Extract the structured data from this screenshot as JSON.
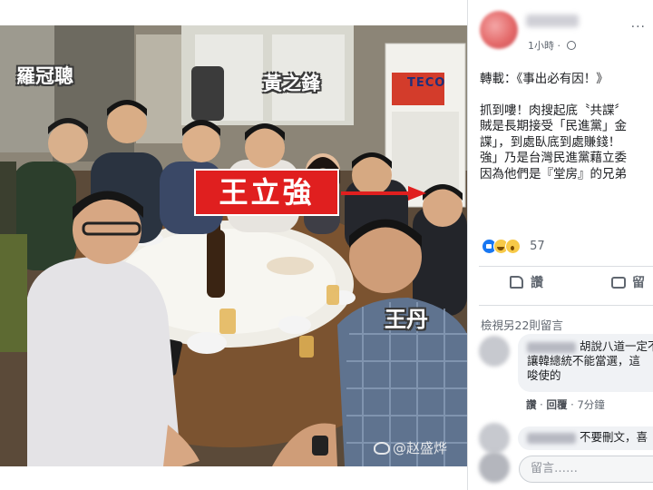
{
  "photo": {
    "caption_left": "羅冠聰",
    "caption_center": "黃之鋒",
    "highlight_label": "王立強",
    "caption_bottom": "王丹",
    "ac_brand": "TECO",
    "watermark": "@赵盛烨"
  },
  "post": {
    "time": "1小時",
    "head": "轉載：《事出必有因！》",
    "lines": [
      "抓到嘍！肉搜起底〝共諜〞",
      "賊是長期接受「民進黨」金",
      "諜」，到處臥底到處賺錢！",
      "強」乃是台灣民進黨藉立委",
      "因為他們是『堂房』的兄弟"
    ],
    "reaction_count": "57"
  },
  "actions": {
    "like": "讚",
    "comment": "留"
  },
  "comments": {
    "view_more": "檢視另22則留言",
    "c1_lines": [
      "胡說八道一定不",
      "讓韓總統不能當選，這",
      "唆使的"
    ],
    "c1_like": "讚",
    "c1_reply": "回覆",
    "c1_time": "7分鐘",
    "c2_text": "不要刪文，喜",
    "input_placeholder": "留言……"
  },
  "colors": {
    "highlight_red": "#e01f1f",
    "facebook_blue": "#1877f2"
  }
}
